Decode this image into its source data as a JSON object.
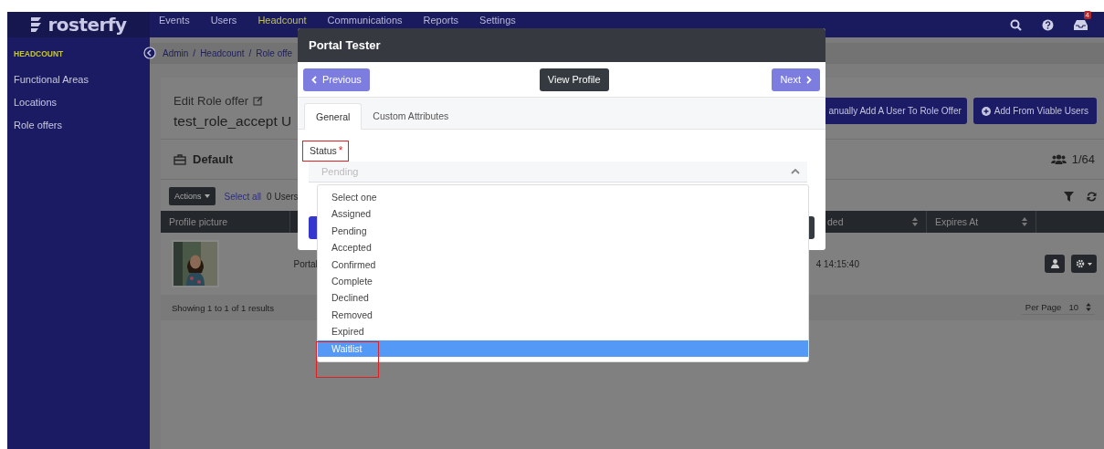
{
  "top_nav": {
    "logo": "rosterfy",
    "items": [
      {
        "label": "Events",
        "selected": false
      },
      {
        "label": "Users",
        "selected": false
      },
      {
        "label": "Headcount",
        "selected": true
      },
      {
        "label": "Communications",
        "selected": false
      },
      {
        "label": "Reports",
        "selected": false
      },
      {
        "label": "Settings",
        "selected": false
      }
    ],
    "notification_count": "4"
  },
  "sidebar": {
    "section": "HEADCOUNT",
    "items": [
      "Functional Areas",
      "Locations",
      "Role offers"
    ]
  },
  "breadcrumb": [
    {
      "label": "Admin"
    },
    {
      "separator": "/",
      "label": "Headcount"
    },
    {
      "separator": "/",
      "label": "Role offe"
    }
  ],
  "page": {
    "subtitle": "Edit Role offer",
    "title": "test_role_accept U",
    "actions": [
      "anually Add A User To Role Offer",
      "Add From Viable Users"
    ]
  },
  "group": {
    "name": "Default",
    "count": "1/64"
  },
  "toolbar": {
    "actions": "Actions",
    "select_all": "Select all",
    "users": "0 Users"
  },
  "table": {
    "columns": [
      "Profile picture",
      "ded",
      "Expires At"
    ],
    "rows": [
      {
        "name": "Portal",
        "date": "4 14:15:40"
      }
    ]
  },
  "footer": {
    "summary": "Showing 1 to 1 of 1 results",
    "per_page_label": "Per Page",
    "per_page": "10"
  },
  "modal": {
    "title": "Portal Tester",
    "previous": "Previous",
    "view_profile": "View Profile",
    "next": "Next",
    "tabs": [
      {
        "label": "General",
        "selected": true
      },
      {
        "label": "Custom Attributes",
        "selected": false
      }
    ],
    "field": {
      "label": "Status",
      "required_mark": "*",
      "annotated": true,
      "placeholder": "Pending",
      "expanded": true,
      "options": [
        {
          "label": "Select one",
          "selected": false,
          "annotated": false
        },
        {
          "label": "Assigned",
          "selected": false,
          "annotated": false
        },
        {
          "label": "Pending",
          "selected": false,
          "annotated": false
        },
        {
          "label": "Accepted",
          "selected": false,
          "annotated": false
        },
        {
          "label": "Confirmed",
          "selected": false,
          "annotated": false
        },
        {
          "label": "Complete",
          "selected": false,
          "annotated": false
        },
        {
          "label": "Declined",
          "selected": false,
          "annotated": false
        },
        {
          "label": "Removed",
          "selected": false,
          "annotated": false
        },
        {
          "label": "Expired",
          "selected": false,
          "annotated": false
        },
        {
          "label": "Waitlist",
          "selected": true,
          "annotated": true
        }
      ]
    }
  }
}
